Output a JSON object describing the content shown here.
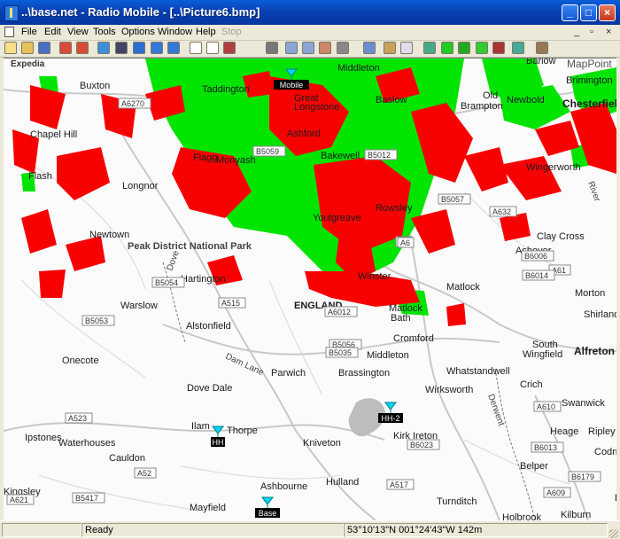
{
  "window": {
    "title": "..\\base.net - Radio Mobile - [..\\Picture6.bmp]"
  },
  "menu": {
    "file": "File",
    "edit": "Edit",
    "view": "View",
    "tools": "Tools",
    "options": "Options",
    "window": "Window",
    "help": "Help",
    "stop": "Stop"
  },
  "toolbar_icons": [
    "new-icon",
    "open-icon",
    "save-icon",
    "network-properties-icon",
    "links-icon",
    "world-icon",
    "print-preview-icon",
    "globe-icon",
    "back-icon",
    "forward-icon",
    "copy-window-icon",
    "window-icon",
    "picture-icon",
    "print-icon",
    "copy-icon",
    "paste-icon",
    "merge-icon",
    "gear-icon",
    "map-properties-icon",
    "person-icon",
    "grid-icon",
    "antenna-icon",
    "coverage-icon",
    "polar-coverage-icon",
    "radio-icon",
    "route-icon",
    "elevation-icon",
    "exit-icon"
  ],
  "map": {
    "watermark_left": "Expedia",
    "watermark_right": "MapPoint",
    "towns": [
      {
        "name": "Buxton",
        "bold": false
      },
      {
        "name": "Middleton",
        "bold": false
      },
      {
        "name": "Barlow",
        "bold": false
      },
      {
        "name": "Brimington",
        "bold": false
      },
      {
        "name": "Chesterfield",
        "bold": true
      },
      {
        "name": "Great",
        "bold": false
      },
      {
        "name": "Longstone",
        "bold": false
      },
      {
        "name": "Baslow",
        "bold": false
      },
      {
        "name": "Old",
        "bold": false
      },
      {
        "name": "Brampton",
        "bold": false
      },
      {
        "name": "Newbold",
        "bold": false
      },
      {
        "name": "Taddington",
        "bold": false
      },
      {
        "name": "Chapel Hill",
        "bold": false
      },
      {
        "name": "Ashford",
        "bold": false
      },
      {
        "name": "Flagg",
        "bold": false
      },
      {
        "name": "Bakewell",
        "bold": false
      },
      {
        "name": "Wingerworth",
        "bold": false
      },
      {
        "name": "Flash",
        "bold": false
      },
      {
        "name": "Monyash",
        "bold": false
      },
      {
        "name": "Longnor",
        "bold": false
      },
      {
        "name": "Youlgreave",
        "bold": false
      },
      {
        "name": "Rowsley",
        "bold": false
      },
      {
        "name": "Newtown",
        "bold": false
      },
      {
        "name": "Clay Cross",
        "bold": false
      },
      {
        "name": "Ashover",
        "bold": false
      },
      {
        "name": "Hartington",
        "bold": false
      },
      {
        "name": "Winster",
        "bold": false
      },
      {
        "name": "Matlock",
        "bold": false
      },
      {
        "name": "Morton",
        "bold": false
      },
      {
        "name": "Warslow",
        "bold": false
      },
      {
        "name": "ENGLAND",
        "bold": true
      },
      {
        "name": "Matlock",
        "bold": false
      },
      {
        "name": "Bath",
        "bold": false
      },
      {
        "name": "Shirland",
        "bold": false
      },
      {
        "name": "Alstonfield",
        "bold": false
      },
      {
        "name": "Cromford",
        "bold": false
      },
      {
        "name": "South",
        "bold": false
      },
      {
        "name": "Wingfield",
        "bold": false
      },
      {
        "name": "Alfreton",
        "bold": true
      },
      {
        "name": "Onecote",
        "bold": false
      },
      {
        "name": "Middleton",
        "bold": false
      },
      {
        "name": "Parwich",
        "bold": false
      },
      {
        "name": "Brassington",
        "bold": false
      },
      {
        "name": "Whatstandwell",
        "bold": false
      },
      {
        "name": "Dove Dale",
        "bold": false
      },
      {
        "name": "Wirksworth",
        "bold": false
      },
      {
        "name": "Crich",
        "bold": false
      },
      {
        "name": "Swanwick",
        "bold": false
      },
      {
        "name": "Ilam",
        "bold": false
      },
      {
        "name": "Thorpe",
        "bold": false
      },
      {
        "name": "Kirk Ireton",
        "bold": false
      },
      {
        "name": "Ipstones",
        "bold": false
      },
      {
        "name": "Waterhouses",
        "bold": false
      },
      {
        "name": "Heage",
        "bold": false
      },
      {
        "name": "Ripley",
        "bold": false
      },
      {
        "name": "Kniveton",
        "bold": false
      },
      {
        "name": "Cauldon",
        "bold": false
      },
      {
        "name": "Codnor",
        "bold": false
      },
      {
        "name": "Belper",
        "bold": false
      },
      {
        "name": "Hulland",
        "bold": false
      },
      {
        "name": "Kingsley",
        "bold": false
      },
      {
        "name": "Ashbourne",
        "bold": false
      },
      {
        "name": "Denby",
        "bold": false
      },
      {
        "name": "Turnditch",
        "bold": false
      },
      {
        "name": "Mayfield",
        "bold": false
      },
      {
        "name": "Holbrook",
        "bold": false
      },
      {
        "name": "Kilburn",
        "bold": false
      }
    ],
    "region_labels": [
      "Peak District National Park"
    ],
    "road_labels": [
      "Dam Lane",
      "Derwent",
      "River",
      "Dove"
    ],
    "road_shields": [
      "A6270",
      "B5059",
      "B5012",
      "A6",
      "B5057",
      "A632",
      "B6006",
      "A61",
      "B6014",
      "B5054",
      "A515",
      "A6012",
      "B5053",
      "B5056",
      "B5035",
      "A523",
      "A6",
      "B6023",
      "A52",
      "B5417",
      "A517",
      "A609",
      "B6179",
      "B6013",
      "A610",
      "A621"
    ],
    "sites": [
      {
        "label": "Mobile",
        "color": "#00d7f0"
      },
      {
        "label": "HH-2",
        "color": "#00d7f0"
      },
      {
        "label": "HH",
        "color": "#00d7f0"
      },
      {
        "label": "Base",
        "color": "#00d7f0"
      }
    ],
    "coverage_colors": {
      "good": "#00e400",
      "weak": "#f80000"
    }
  },
  "status": {
    "text": "Ready",
    "coordinates": "53°10'13\"N 001°24'43\"W 142m"
  }
}
